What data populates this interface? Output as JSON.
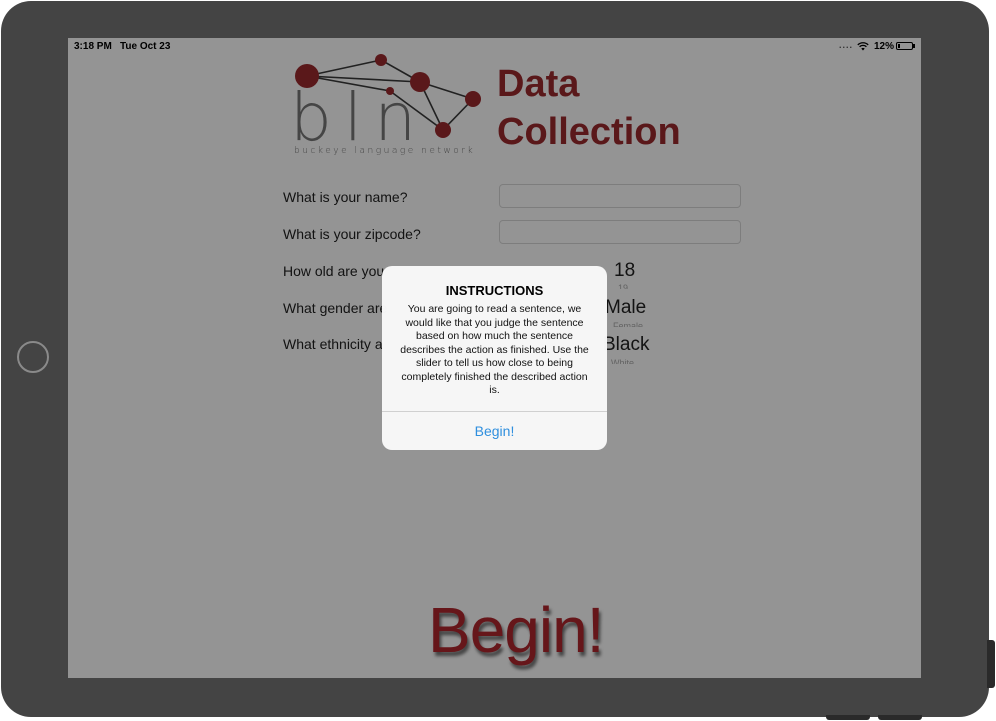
{
  "status_bar": {
    "time": "3:18 PM",
    "date": "Tue Oct 23",
    "signal": "....",
    "battery_text": "12%",
    "battery_level": 0.12
  },
  "logo": {
    "letters": "bln",
    "subtitle": "buckeye language network"
  },
  "title": {
    "line1": "Data",
    "line2": "Collection",
    "color": "#9b2a2e"
  },
  "form": {
    "name_label": "What is your name?",
    "name_value": "",
    "zip_label": "What is your zipcode?",
    "zip_value": "",
    "age_label": "How old are you",
    "age_value": "18",
    "age_next": "19",
    "gender_label": "What gender are",
    "gender_value": "Male",
    "gender_next": "Female",
    "ethnicity_label": "What ethnicity a",
    "ethnicity_value": "Black",
    "ethnicity_next": "White"
  },
  "begin_button": {
    "label": "Begin!",
    "color": "#b0262d"
  },
  "alert": {
    "title": "INSTRUCTIONS",
    "message": "You are going to read a sentence, we would like that you judge the sentence based on how much the sentence describes the action as finished. Use the slider to tell us how close to being completely finished the described action is.",
    "button": "Begin!",
    "button_color": "#2f8fde"
  },
  "icons": {
    "wifi": "wifi-icon",
    "battery": "battery-icon",
    "home": "home-button-icon"
  }
}
